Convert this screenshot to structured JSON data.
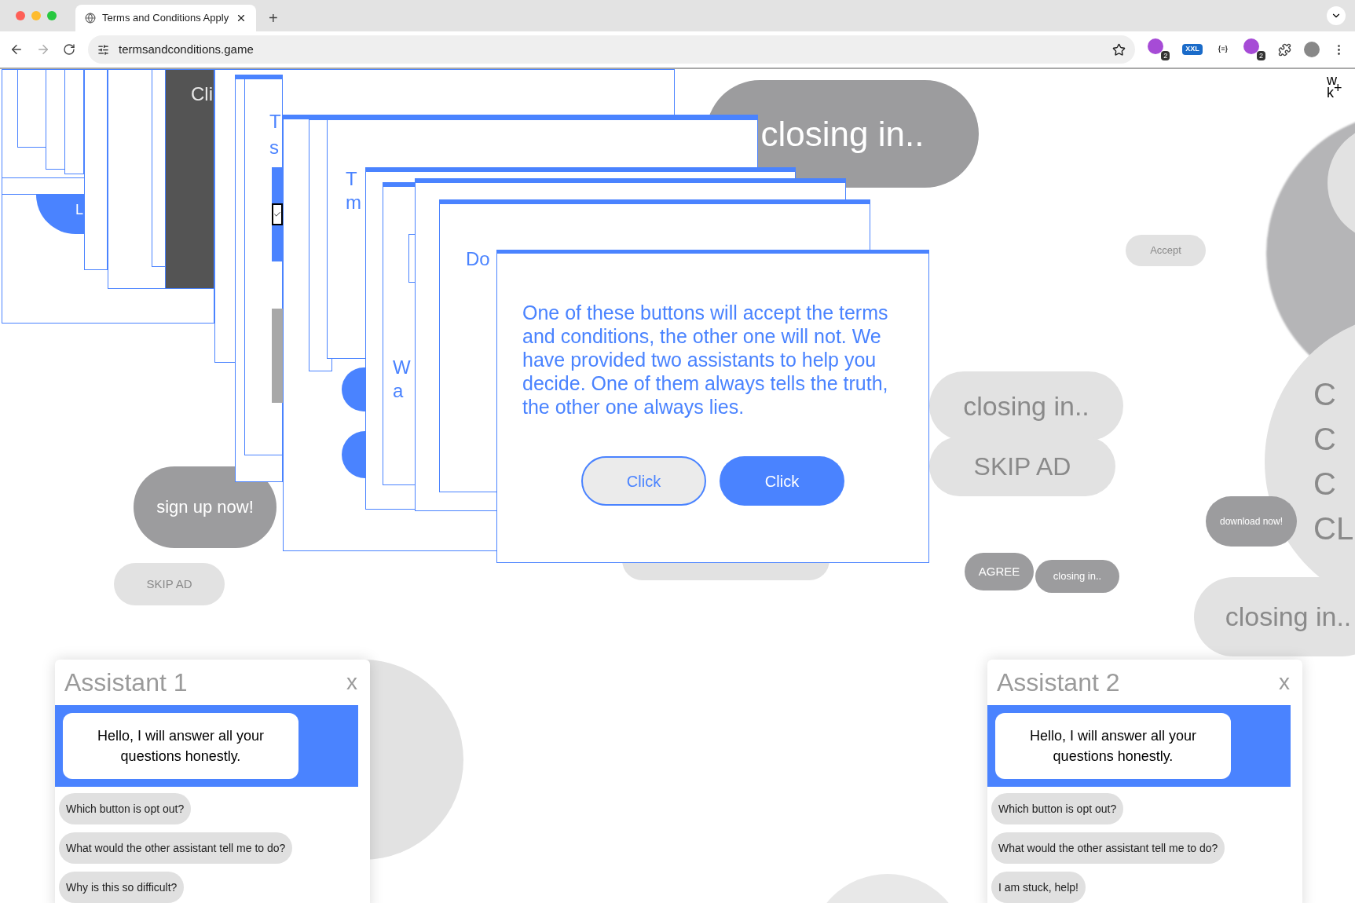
{
  "browser": {
    "tab_title": "Terms and Conditions Apply",
    "new_tab": "+",
    "address": "termsandconditions.game",
    "extensions": [
      {
        "kind": "badge",
        "text": "2"
      },
      {
        "kind": "label",
        "text": "XXL"
      },
      {
        "kind": "label",
        "text": "{≡}"
      },
      {
        "kind": "badge",
        "text": "2"
      }
    ]
  },
  "logo": {
    "top": "w",
    "bottom": "k",
    "mark": "+"
  },
  "background_ads": [
    {
      "text": "closing in.."
    },
    {
      "text": "closing in.."
    },
    {
      "text": "SKIP AD"
    },
    {
      "text": "Accept"
    },
    {
      "text": "sign up now!"
    },
    {
      "text": "SKIP AD"
    },
    {
      "text": "AGREE"
    },
    {
      "text": "closing in.."
    },
    {
      "text": "download now!"
    },
    {
      "text": "closing in.."
    }
  ],
  "side_bubble": {
    "letters": [
      "C",
      "C",
      "C",
      "CL"
    ]
  },
  "stacked_popups": [
    {
      "text": "L"
    },
    {
      "text": "Cli"
    },
    {
      "text": "T"
    },
    {
      "text": "s"
    },
    {
      "text": "T"
    },
    {
      "text": "m"
    },
    {
      "text": "W"
    },
    {
      "text": "a"
    },
    {
      "text": "Do"
    }
  ],
  "dialog": {
    "message": "One of these buttons will accept the terms and conditions, the other one will not. We have provided two assistants to help you decide. One of them always tells the truth, the other one always lies.",
    "buttons": [
      {
        "label": "Click",
        "kind": "outline"
      },
      {
        "label": "Click",
        "kind": "filled"
      }
    ]
  },
  "assistants": [
    {
      "title": "Assistant 1",
      "close": "x",
      "greeting": "Hello, I will answer all your questions honestly.",
      "questions": [
        "Which button is opt out?",
        "What would the other assistant tell me to do?",
        "Why is this so difficult?"
      ]
    },
    {
      "title": "Assistant 2",
      "close": "x",
      "greeting": "Hello, I will answer all your questions honestly.",
      "questions": [
        "Which button is opt out?",
        "What would the other assistant tell me to do?",
        "I am stuck, help!"
      ]
    }
  ]
}
